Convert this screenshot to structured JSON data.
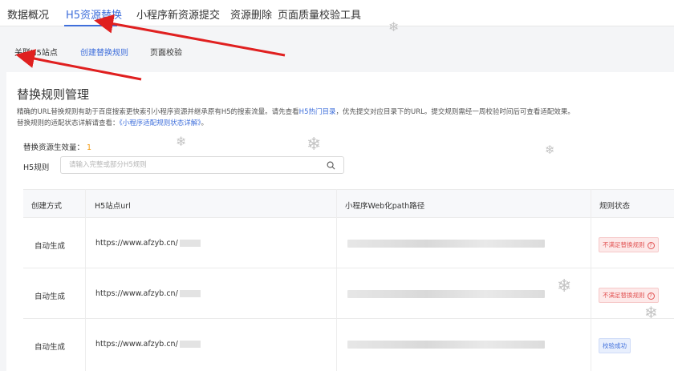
{
  "top_tabs": [
    "数据概况",
    "H5资源替换",
    "小程序新资源提交",
    "资源删除",
    "页面质量校验工具"
  ],
  "sub_tabs": [
    "关联H5站点",
    "创建替换规则",
    "页面校验"
  ],
  "section": {
    "title": "替换规则管理",
    "desc1_a": "精确的URL替换规则有助于百度搜索更快索引小程序资源并继承原有H5的搜索流量。请先查看",
    "desc1_link": "H5热门目录",
    "desc1_b": "，优先提交对应目录下的URL。提交规则需经一周校验时间后可查看适配效果。",
    "desc2_a": "替换规则的适配状态详解请查看：",
    "desc2_link": "《小程序适配规则状态详解》",
    "desc2_b": "。"
  },
  "effective": {
    "label": "替换资源生效量：",
    "value": "1"
  },
  "filter": {
    "label": "H5规则",
    "placeholder": "请输入完整或部分H5规则"
  },
  "table": {
    "headers": [
      "创建方式",
      "H5站点url",
      "小程序Web化path路径",
      "规则状态"
    ],
    "rows": [
      {
        "method": "自动生成",
        "url": "https://www.afzyb.cn/",
        "status": "不满足替换规则"
      },
      {
        "method": "自动生成",
        "url": "https://www.afzyb.cn/",
        "status": "不满足替换规则"
      },
      {
        "method": "自动生成",
        "url": "https://www.afzyb.cn/",
        "status": "校验成功"
      }
    ]
  },
  "colors": {
    "accent": "#3f6fdb",
    "warning": "#f39c12",
    "error": "#e25555",
    "arrow": "#e02020"
  }
}
